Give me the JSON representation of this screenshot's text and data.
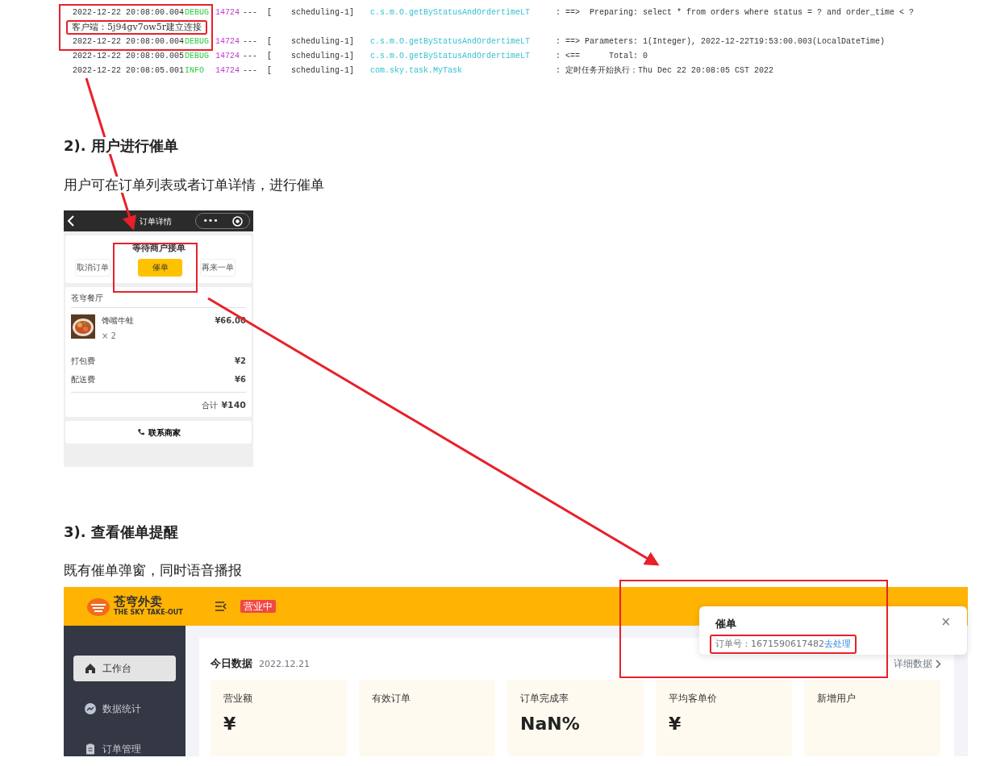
{
  "log_lines": [
    {
      "kind": "log",
      "time": "2022-12-22 20:08:00.004",
      "level": "DEBUG",
      "pid": "14724",
      "sep": "---",
      "thread": "[    scheduling-1]",
      "logger": "c.s.m.O.getByStatusAndOrdertimeLT",
      "message": ": ==>  Preparing: select * from orders where status = ? and order_time < ?"
    },
    {
      "kind": "plain",
      "text": "客户端：5j94gv7ow5r建立连接"
    },
    {
      "kind": "log",
      "time": "2022-12-22 20:08:00.004",
      "level": "DEBUG",
      "pid": "14724",
      "sep": "---",
      "thread": "[    scheduling-1]",
      "logger": "c.s.m.O.getByStatusAndOrdertimeLT",
      "message": ": ==> Parameters: 1(Integer), 2022-12-22T19:53:00.003(LocalDateTime)"
    },
    {
      "kind": "log",
      "time": "2022-12-22 20:08:00.005",
      "level": "DEBUG",
      "pid": "14724",
      "sep": "---",
      "thread": "[    scheduling-1]",
      "logger": "c.s.m.O.getByStatusAndOrdertimeLT",
      "message": ": <==      Total: 0"
    },
    {
      "kind": "log",
      "time": "2022-12-22 20:08:05.001",
      "level": "INFO",
      "pid": "14724",
      "sep": "---",
      "thread": "[    scheduling-1]",
      "logger": "com.sky.task.MyTask",
      "message": ": 定时任务开始执行：Thu Dec 22 20:08:05 CST 2022"
    }
  ],
  "section_2": {
    "heading": "2). 用户进行催单",
    "text": "用户可在订单列表或者订单详情，进行催单"
  },
  "phone": {
    "title": "订单详情",
    "capsule_dots": "•••",
    "status": "等待商户接单",
    "actions": [
      {
        "label": "取消订单",
        "highlighted": false
      },
      {
        "label": "催单",
        "highlighted": true
      },
      {
        "label": "再来一单",
        "highlighted": false
      }
    ],
    "shop": "苍穹餐厅",
    "dish": {
      "name": "馋嘴牛蛙",
      "qty": "× 2",
      "price": "¥66.00"
    },
    "fees": [
      {
        "label": "打包费",
        "value": "¥2"
      },
      {
        "label": "配送费",
        "value": "¥6"
      }
    ],
    "total_label": "合计",
    "total": "¥140",
    "contact": "联系商家"
  },
  "section_3": {
    "heading": "3). 查看催单提醒",
    "text": "既有催单弹窗，同时语音播报"
  },
  "admin": {
    "logo_text": "苍穹外卖",
    "logo_subtitle": "THE SKY TAKE-OUT",
    "shop_status": "营业中",
    "sidebar": [
      {
        "label": "工作台",
        "selected": true
      },
      {
        "label": "数据统计",
        "selected": false
      },
      {
        "label": "订单管理",
        "selected": false
      }
    ],
    "panel_title": "今日数据",
    "panel_date": "2022.12.21",
    "details_link": "详细数据",
    "stats": [
      {
        "label": "营业额",
        "value": "¥"
      },
      {
        "label": "有效订单"
      },
      {
        "label": "订单完成率",
        "value": "NaN%"
      },
      {
        "label": "平均客单价",
        "value": "¥"
      },
      {
        "label": "新增用户"
      }
    ],
    "toast": {
      "title": "催单",
      "text": "订单号：1671590617482",
      "link": "去处理",
      "close": "×"
    }
  }
}
